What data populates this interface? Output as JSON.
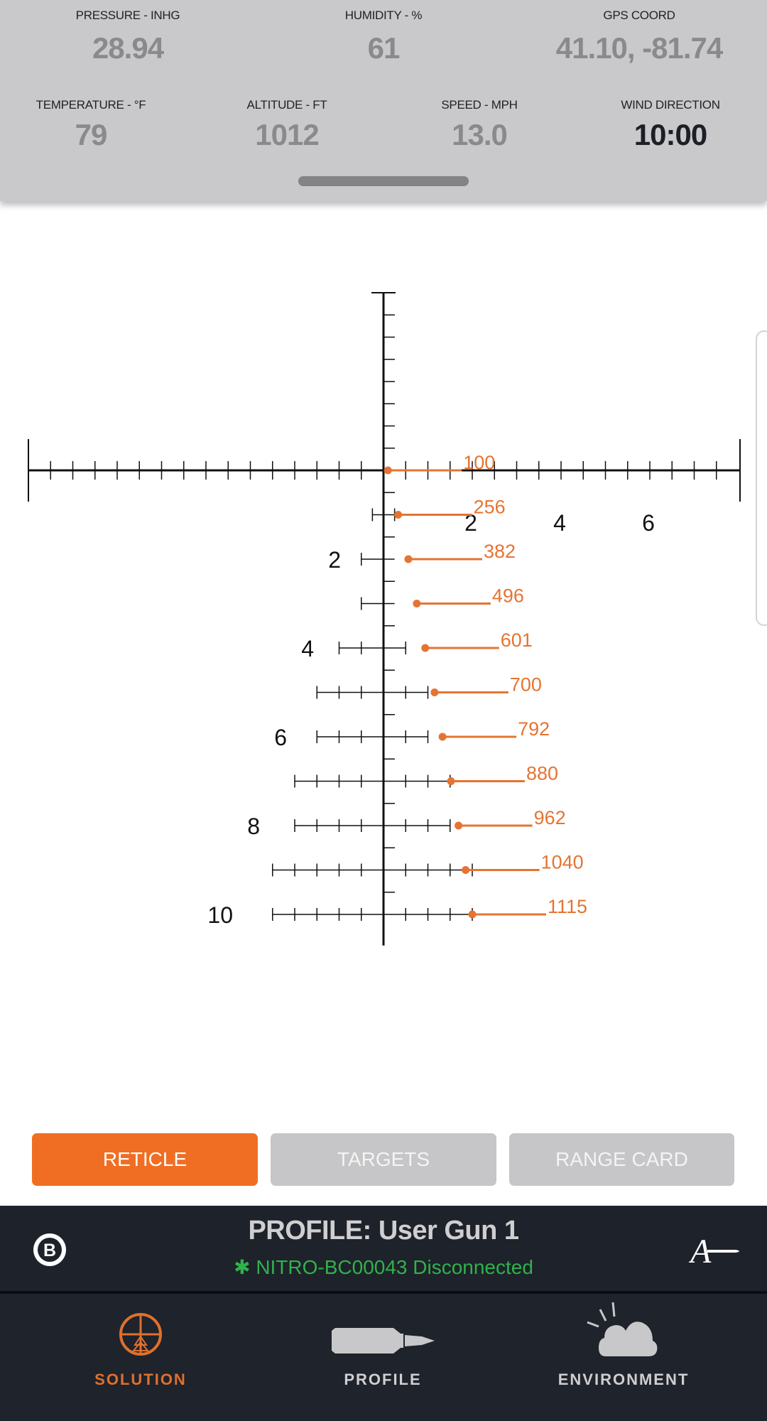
{
  "environment": {
    "pressure": {
      "label": "PRESSURE - INHG",
      "value": "28.94"
    },
    "humidity": {
      "label": "HUMIDITY - %",
      "value": "61"
    },
    "gps": {
      "label": "GPS COORD",
      "value": "41.10, -81.74"
    },
    "temperature": {
      "label": "TEMPERATURE - °F",
      "value": "79"
    },
    "altitude": {
      "label": "ALTITUDE - FT",
      "value": "1012"
    },
    "speed": {
      "label": "SPEED - MPH",
      "value": "13.0"
    },
    "wind_direction": {
      "label": "WIND DIRECTION",
      "value": "10:00"
    }
  },
  "reticle": {
    "accent_color": "#e57432",
    "windage_labels": [
      "2",
      "4",
      "6"
    ],
    "elevation_labels": [
      "2",
      "4",
      "6",
      "8",
      "10"
    ],
    "holds": [
      {
        "range": "100",
        "elevation_mil": 0,
        "windage_mil": 0.1
      },
      {
        "range": "256",
        "elevation_mil": 1,
        "windage_mil": 0.33
      },
      {
        "range": "382",
        "elevation_mil": 2,
        "windage_mil": 0.56
      },
      {
        "range": "496",
        "elevation_mil": 3,
        "windage_mil": 0.75
      },
      {
        "range": "601",
        "elevation_mil": 4,
        "windage_mil": 0.94
      },
      {
        "range": "700",
        "elevation_mil": 5,
        "windage_mil": 1.15
      },
      {
        "range": "792",
        "elevation_mil": 6,
        "windage_mil": 1.33
      },
      {
        "range": "880",
        "elevation_mil": 7,
        "windage_mil": 1.52
      },
      {
        "range": "962",
        "elevation_mil": 8,
        "windage_mil": 1.69
      },
      {
        "range": "1040",
        "elevation_mil": 9,
        "windage_mil": 1.85
      },
      {
        "range": "1115",
        "elevation_mil": 10,
        "windage_mil": 2.0
      }
    ]
  },
  "tabs": [
    {
      "label": "RETICLE",
      "active": true
    },
    {
      "label": "TARGETS",
      "active": false
    },
    {
      "label": "RANGE CARD",
      "active": false
    }
  ],
  "profile": {
    "title": "PROFILE: User Gun 1",
    "status": "NITRO-BC00043 Disconnected",
    "status_color": "#2fb24b",
    "left_logo": "B",
    "right_logo": "A"
  },
  "nav": [
    {
      "label": "SOLUTION",
      "icon": "reticle-icon",
      "active": true
    },
    {
      "label": "PROFILE",
      "icon": "bullet-icon",
      "active": false
    },
    {
      "label": "ENVIRONMENT",
      "icon": "weather-icon",
      "active": false
    }
  ],
  "colors": {
    "accent": "#f06e23",
    "panel": "#c9c9cb",
    "dark": "#1e222a"
  }
}
